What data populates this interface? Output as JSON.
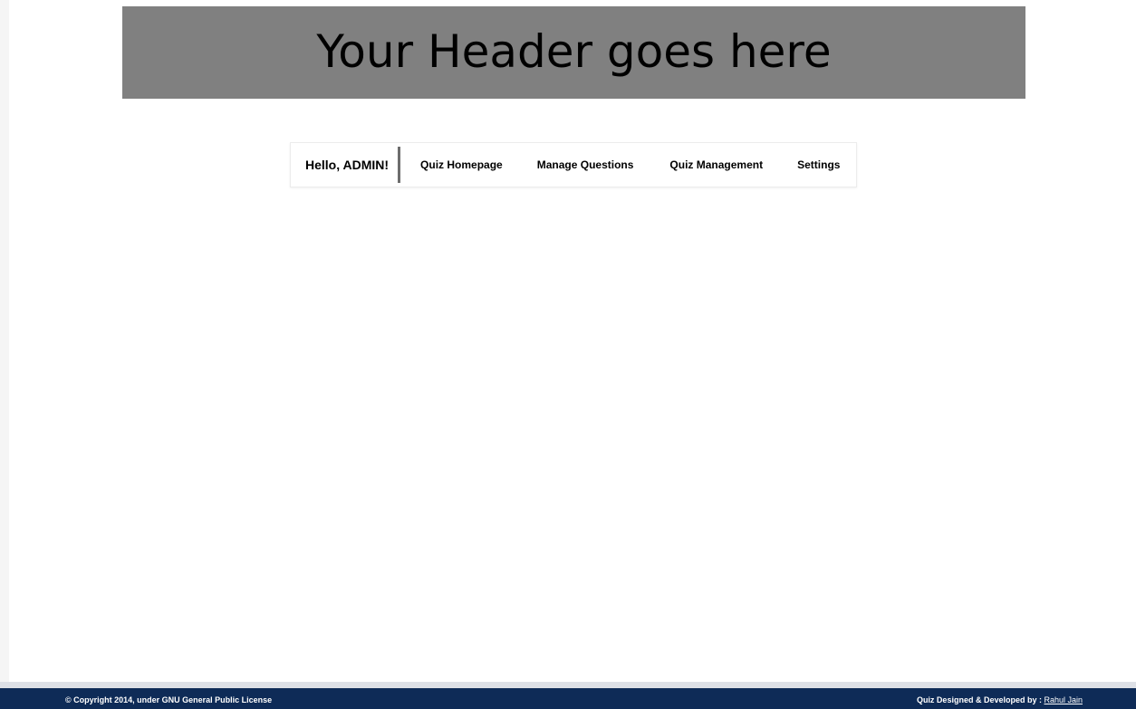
{
  "header": {
    "title": "Your Header goes here"
  },
  "nav": {
    "greeting": "Hello, ADMIN!",
    "items": [
      {
        "label": "Quiz Homepage"
      },
      {
        "label": "Manage Questions"
      },
      {
        "label": "Quiz Management"
      },
      {
        "label": "Settings"
      }
    ]
  },
  "footer": {
    "copyright": "© Copyright 2014, under GNU General Public License",
    "credit_prefix": "Quiz Designed & Developed by : ",
    "credit_link": "Rahul Jain"
  },
  "colors": {
    "header_bg": "#808080",
    "footer_bg": "#0e2b57",
    "divider": "#6d6d6d"
  }
}
